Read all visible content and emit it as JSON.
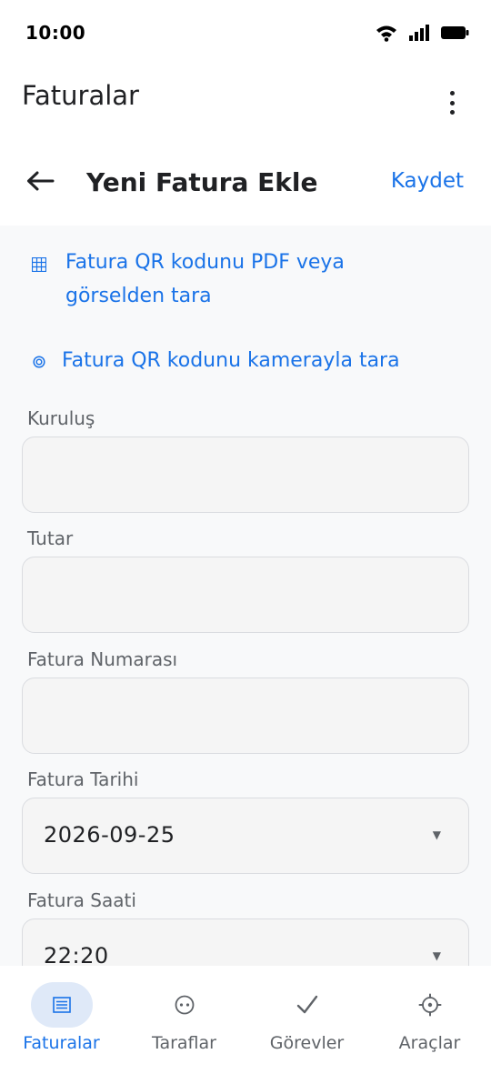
{
  "status_bar": {
    "time": "10:00"
  },
  "app_bar": {
    "title": "Faturalar"
  },
  "sub_header": {
    "title": "Yeni Fatura Ekle",
    "save_label": "Kaydet"
  },
  "scan_actions": {
    "pdf_label": "Fatura QR kodunu PDF veya görselden tara",
    "camera_label": "Fatura QR kodunu kamerayla tara"
  },
  "form": {
    "institution_label": "Kuruluş",
    "institution_value": "",
    "amount_label": "Tutar",
    "amount_value": "",
    "invoice_number_label": "Fatura Numarası",
    "invoice_number_value": "",
    "invoice_date_label": "Fatura Tarihi",
    "invoice_date_value": "2026-09-25",
    "invoice_time_label": "Fatura Saati",
    "invoice_time_value": "22:20"
  },
  "bottom_nav": {
    "invoices": "Faturalar",
    "parties": "Taraflar",
    "tasks": "Görevler",
    "tools": "Araçlar"
  },
  "colors": {
    "accent": "#1a73e8",
    "active_pill": "#dfe9f8",
    "text": "#202124",
    "muted": "#5f6368"
  }
}
